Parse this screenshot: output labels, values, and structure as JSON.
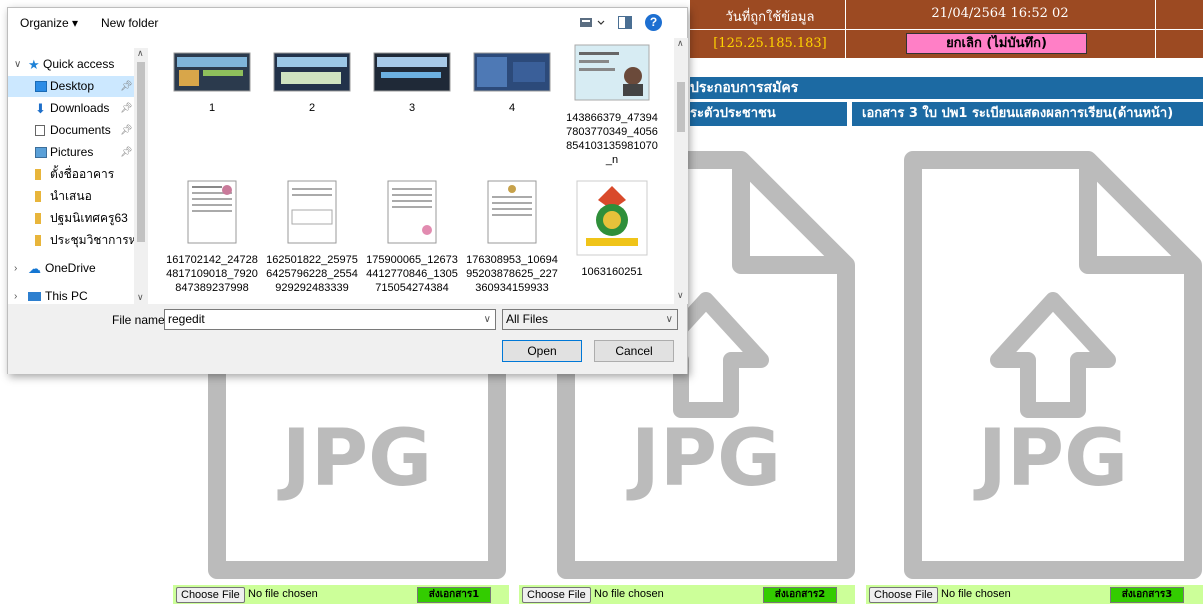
{
  "web": {
    "date_label": "วันที่ถูกใช้ข้อมูล",
    "date_value": "21/04/2564 16:52 02",
    "ip": "[125.25.185.183]",
    "cancel_label": "ยกเลิก (ไม่บันทึก)",
    "section_title": "ประกอบการสมัคร",
    "col2_header": "ระตัวประชาชน",
    "col3_header": "เอกสาร 3 ใบ ปพ1 ระเบียนแสดงผลการเรียน(ด้านหน้า)",
    "jpg_text": "JPG",
    "uploads": [
      {
        "choose": "Choose File",
        "status": "No file chosen",
        "send": "ส่งเอกสาร1"
      },
      {
        "choose": "Choose File",
        "status": "No file chosen",
        "send": "ส่งเอกสาร2"
      },
      {
        "choose": "Choose File",
        "status": "No file chosen",
        "send": "ส่งเอกสาร3"
      }
    ]
  },
  "dialog": {
    "organize": "Organize ▾",
    "new_folder": "New folder",
    "help": "?",
    "nav": [
      {
        "label": "Quick access",
        "icon": "star-icon"
      },
      {
        "label": "Desktop",
        "icon": "desktop-icon"
      },
      {
        "label": "Downloads",
        "icon": "download-icon"
      },
      {
        "label": "Documents",
        "icon": "documents-icon"
      },
      {
        "label": "Pictures",
        "icon": "pictures-icon"
      },
      {
        "label": "ตั้งชื่ออาคาร",
        "icon": "folder-icon"
      },
      {
        "label": "นำเสนอ",
        "icon": "folder-icon"
      },
      {
        "label": "ปฐมนิเทศครู63",
        "icon": "folder-icon"
      },
      {
        "label": "ประชุมวิชาการหลัก",
        "icon": "folder-icon"
      },
      {
        "label": "OneDrive",
        "icon": "cloud-icon"
      },
      {
        "label": "This PC",
        "icon": "computer-icon"
      }
    ],
    "files": [
      {
        "name": "1",
        "icon": "image-thumbnail-icon"
      },
      {
        "name": "2",
        "icon": "image-thumbnail-icon"
      },
      {
        "name": "3",
        "icon": "image-thumbnail-icon"
      },
      {
        "name": "4",
        "icon": "image-thumbnail-icon"
      },
      {
        "name": "143866379_473947803770349_4056854103135981070_n",
        "icon": "id-card-thumbnail-icon"
      },
      {
        "name": "161702142_247284817109018_7920847389237998",
        "icon": "document-thumbnail-icon"
      },
      {
        "name": "162501822_259756425796228_2554929292483339",
        "icon": "document-thumbnail-icon"
      },
      {
        "name": "175900065_126734412770846_1305715054274384",
        "icon": "document-thumbnail-icon"
      },
      {
        "name": "176308953_1069495203878625_227360934159933",
        "icon": "document-thumbnail-icon"
      },
      {
        "name": "1063160251",
        "icon": "emblem-thumbnail-icon"
      }
    ],
    "file_name_label": "File name:",
    "file_name_value": "regedit",
    "filter_value": "All Files",
    "open_label": "Open",
    "cancel_label": "Cancel"
  }
}
